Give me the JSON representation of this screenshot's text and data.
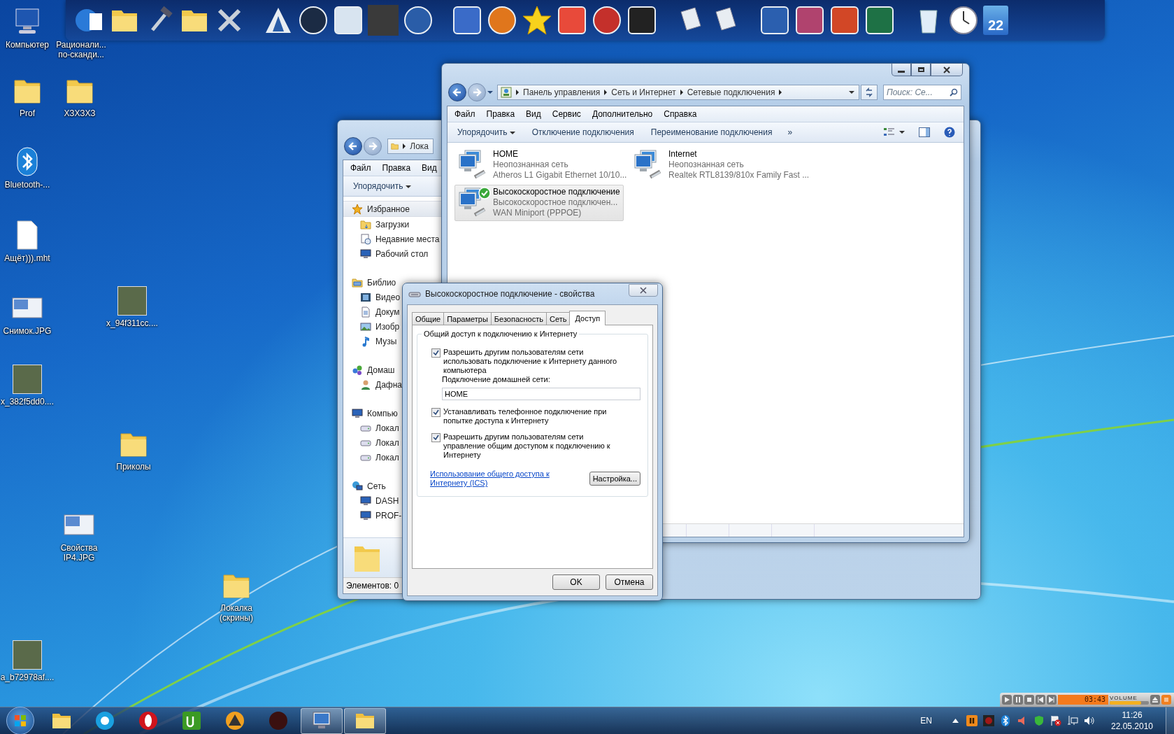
{
  "desktop_icons": [
    {
      "label": "Компьютер",
      "kind": "computer"
    },
    {
      "label": "Рационали... по-сканди...",
      "kind": "app"
    },
    {
      "label": "Prof",
      "kind": "folder"
    },
    {
      "label": "ХЗХЗХЗ",
      "kind": "folder"
    },
    {
      "label": "Bluetooth-...",
      "kind": "bluetooth"
    },
    {
      "label": "Ащёт))).mht",
      "kind": "file"
    },
    {
      "label": "Снимок.JPG",
      "kind": "screenshot"
    },
    {
      "label": "x_94f311cc....",
      "kind": "photo"
    },
    {
      "label": "x_382f5dd0....",
      "kind": "photo"
    },
    {
      "label": "Приколы",
      "kind": "folder"
    },
    {
      "label": "Свойства IP4.JPG",
      "kind": "screenshot"
    },
    {
      "label": "Локалка (скрины)",
      "kind": "folder"
    },
    {
      "label": "a_b72978af....",
      "kind": "photo"
    }
  ],
  "dock": {
    "calendar_day": "22"
  },
  "explorer_window": {
    "address": "Лока",
    "menu": [
      "Файл",
      "Правка",
      "Вид"
    ],
    "organize": "Упорядочить",
    "nav": [
      {
        "label": "Избранное",
        "kind": "star",
        "selected": true,
        "children": [
          {
            "label": "Загрузки",
            "kind": "folder",
            "selected": false
          },
          {
            "label": "Недавние места",
            "kind": "recent",
            "selected": false
          },
          {
            "label": "Рабочий стол",
            "kind": "desktop",
            "selected": false
          }
        ]
      },
      {
        "label": "Библио",
        "kind": "library",
        "selected": false,
        "children": [
          {
            "label": "Видео",
            "kind": "video",
            "selected": false
          },
          {
            "label": "Докум",
            "kind": "document",
            "selected": false
          },
          {
            "label": "Изобр",
            "kind": "picture",
            "selected": false
          },
          {
            "label": "Музы",
            "kind": "music",
            "selected": false
          }
        ]
      },
      {
        "label": "Домаш",
        "kind": "homegroup",
        "selected": false,
        "children": [
          {
            "label": "Дафна",
            "kind": "user",
            "selected": false
          }
        ]
      },
      {
        "label": "Компью",
        "kind": "computer",
        "selected": false,
        "children": [
          {
            "label": "Локал",
            "kind": "drive",
            "selected": false
          },
          {
            "label": "Локал",
            "kind": "drive",
            "selected": false
          },
          {
            "label": "Локал",
            "kind": "drive",
            "selected": false
          }
        ]
      },
      {
        "label": "Сеть",
        "kind": "network",
        "selected": false,
        "children": [
          {
            "label": "DASH",
            "kind": "pc",
            "selected": false
          },
          {
            "label": "PROF-",
            "kind": "pc",
            "selected": false
          }
        ]
      }
    ],
    "status": "Элементов: 0"
  },
  "network_window": {
    "breadcrumb": [
      "Панель управления",
      "Сеть и Интернет",
      "Сетевые подключения"
    ],
    "search_placeholder": "Поиск: Се...",
    "menu": [
      "Файл",
      "Правка",
      "Вид",
      "Сервис",
      "Дополнительно",
      "Справка"
    ],
    "toolbar": [
      {
        "label": "Упорядочить",
        "kind": "dropdown"
      },
      {
        "label": "Отключение подключения",
        "kind": "command"
      },
      {
        "label": "Переименование подключения",
        "kind": "command"
      },
      {
        "label": "»",
        "kind": "overflow"
      }
    ],
    "connections": [
      {
        "name": "HOME",
        "status": "Неопознанная сеть",
        "adapter": "Atheros L1 Gigabit Ethernet 10/10...",
        "selected": false,
        "connected": false
      },
      {
        "name": "Internet",
        "status": "Неопознанная сеть",
        "adapter": "Realtek RTL8139/810x Family Fast ...",
        "selected": false,
        "connected": false
      },
      {
        "name": "Высокоскоростное подключение",
        "status": "Высокоскоростное подключен...",
        "adapter": "WAN Miniport (PPPOE)",
        "selected": true,
        "connected": true
      }
    ]
  },
  "dialog": {
    "title": "Высокоскоростное подключение - свойства",
    "tabs": [
      {
        "label": "Общие",
        "selected": false
      },
      {
        "label": "Параметры",
        "selected": false
      },
      {
        "label": "Безопасность",
        "selected": false
      },
      {
        "label": "Сеть",
        "selected": false
      },
      {
        "label": "Доступ",
        "selected": true
      }
    ],
    "group_title": "Общий доступ к подключению к Интернету",
    "options": [
      {
        "label": "Разрешить другим пользователям сети использовать подключение к Интернету данного компьютера",
        "checked": true
      },
      {
        "label": "Устанавливать телефонное подключение при попытке доступа к Интернету",
        "checked": true
      },
      {
        "label": "Разрешить другим пользователям сети управление общим доступом к подключению к Интернету",
        "checked": true
      }
    ],
    "home_network": {
      "label": "Подключение домашней сети:",
      "value": "HOME"
    },
    "link": "Использование общего доступа к Интернету (ICS)",
    "settings_button": "Настройка...",
    "buttons": [
      "OK",
      "Отмена"
    ]
  },
  "media_player": {
    "time": "03:43",
    "volume_label": "VOLUME",
    "volume": {
      "level": 0.8
    }
  },
  "taskbar": {
    "pinned": [
      {
        "running": false
      },
      {
        "running": false
      },
      {
        "running": false
      },
      {
        "running": false
      },
      {
        "running": false
      },
      {
        "running": false
      },
      {
        "running": true
      },
      {
        "running": true
      }
    ],
    "language": "EN",
    "time": "11:26",
    "date": "22.05.2010"
  }
}
